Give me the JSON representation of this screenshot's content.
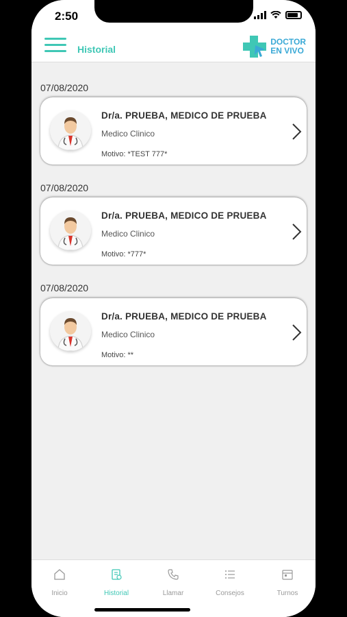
{
  "status_bar": {
    "time": "2:50"
  },
  "header": {
    "title": "Historial",
    "logo_line1": "DOCTOR",
    "logo_line2": "EN VIVO"
  },
  "consultations": [
    {
      "date": "07/08/2020",
      "doctor": "Dr/a. PRUEBA, MEDICO DE PRUEBA",
      "specialty": "Medico Clinico",
      "motivo": "Motivo: *TEST 777*"
    },
    {
      "date": "07/08/2020",
      "doctor": "Dr/a. PRUEBA, MEDICO DE PRUEBA",
      "specialty": "Medico Clinico",
      "motivo": "Motivo: *777*"
    },
    {
      "date": "07/08/2020",
      "doctor": "Dr/a. PRUEBA, MEDICO DE PRUEBA",
      "specialty": "Medico Clinico",
      "motivo": "Motivo: **"
    }
  ],
  "tabbar": {
    "items": [
      {
        "label": "Inicio",
        "icon": "home-icon"
      },
      {
        "label": "Historial",
        "icon": "history-icon",
        "active": true
      },
      {
        "label": "Llamar",
        "icon": "phone-icon"
      },
      {
        "label": "Consejos",
        "icon": "list-icon"
      },
      {
        "label": "Turnos",
        "icon": "calendar-icon"
      }
    ]
  },
  "colors": {
    "accent": "#3fc7b5",
    "logo_blue": "#3aa9d6",
    "background": "#f0f0f0"
  }
}
